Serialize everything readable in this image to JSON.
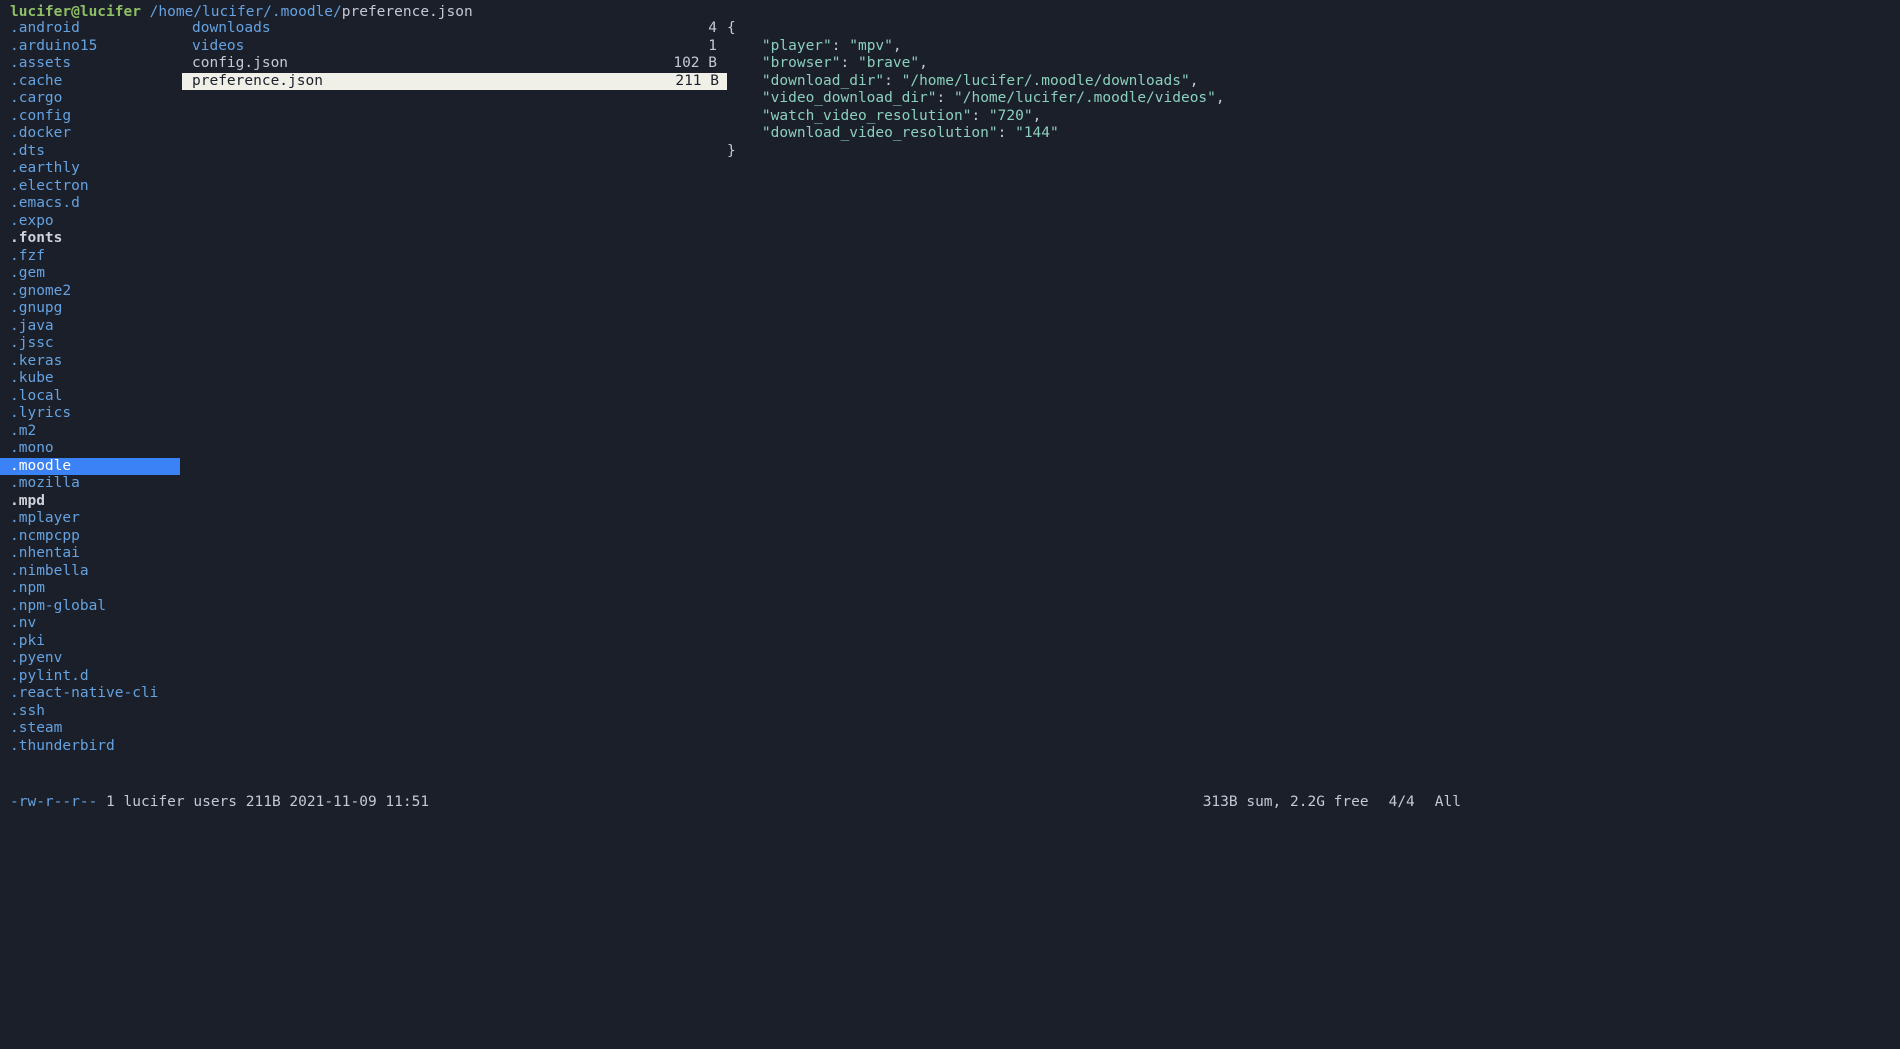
{
  "header": {
    "user_host": "lucifer@lucifer",
    "path_prefix": " /home/lucifer/.moodle/",
    "filename": "preference.json"
  },
  "left_column": [
    {
      "name": ".android",
      "type": "dir"
    },
    {
      "name": ".arduino15",
      "type": "dir"
    },
    {
      "name": ".assets",
      "type": "dir"
    },
    {
      "name": ".cache",
      "type": "dir"
    },
    {
      "name": ".cargo",
      "type": "dir"
    },
    {
      "name": ".config",
      "type": "dir"
    },
    {
      "name": ".docker",
      "type": "dir"
    },
    {
      "name": ".dts",
      "type": "dir"
    },
    {
      "name": ".earthly",
      "type": "dir"
    },
    {
      "name": ".electron",
      "type": "dir"
    },
    {
      "name": ".emacs.d",
      "type": "dir"
    },
    {
      "name": ".expo",
      "type": "dir"
    },
    {
      "name": ".fonts",
      "type": "dir",
      "bold": true
    },
    {
      "name": ".fzf",
      "type": "dir"
    },
    {
      "name": ".gem",
      "type": "dir"
    },
    {
      "name": ".gnome2",
      "type": "dir"
    },
    {
      "name": ".gnupg",
      "type": "dir"
    },
    {
      "name": ".java",
      "type": "dir"
    },
    {
      "name": ".jssc",
      "type": "dir"
    },
    {
      "name": ".keras",
      "type": "dir"
    },
    {
      "name": ".kube",
      "type": "dir"
    },
    {
      "name": ".local",
      "type": "dir"
    },
    {
      "name": ".lyrics",
      "type": "dir"
    },
    {
      "name": ".m2",
      "type": "dir"
    },
    {
      "name": ".mono",
      "type": "dir"
    },
    {
      "name": ".moodle",
      "type": "dir",
      "selected": true
    },
    {
      "name": ".mozilla",
      "type": "dir"
    },
    {
      "name": ".mpd",
      "type": "dir",
      "bold": true
    },
    {
      "name": ".mplayer",
      "type": "dir"
    },
    {
      "name": ".ncmpcpp",
      "type": "dir"
    },
    {
      "name": ".nhentai",
      "type": "dir"
    },
    {
      "name": ".nimbella",
      "type": "dir"
    },
    {
      "name": ".npm",
      "type": "dir"
    },
    {
      "name": ".npm-global",
      "type": "dir"
    },
    {
      "name": ".nv",
      "type": "dir"
    },
    {
      "name": ".pki",
      "type": "dir"
    },
    {
      "name": ".pyenv",
      "type": "dir"
    },
    {
      "name": ".pylint.d",
      "type": "dir"
    },
    {
      "name": ".react-native-cli",
      "type": "dir"
    },
    {
      "name": ".ssh",
      "type": "dir"
    },
    {
      "name": ".steam",
      "type": "dir"
    },
    {
      "name": ".thunderbird",
      "type": "dir"
    }
  ],
  "middle_column": [
    {
      "name": "downloads",
      "type": "dir",
      "size": "4"
    },
    {
      "name": "videos",
      "type": "dir",
      "size": "1"
    },
    {
      "name": "config.json",
      "type": "file",
      "size": "102 B"
    },
    {
      "name": "preference.json",
      "type": "file",
      "size": "211 B",
      "selected": true
    }
  ],
  "preview": {
    "lines": [
      "{",
      "    \"player\": \"mpv\",",
      "    \"browser\": \"brave\",",
      "    \"download_dir\": \"/home/lucifer/.moodle/downloads\",",
      "    \"video_download_dir\": \"/home/lucifer/.moodle/videos\",",
      "    \"watch_video_resolution\": \"720\",",
      "    \"download_video_resolution\": \"144\"",
      "}"
    ]
  },
  "footer": {
    "mode": "-rw-r--r--",
    "links": "1",
    "owner": "lucifer",
    "group": "users",
    "size": "211B",
    "date": "2021-11-09 11:51",
    "sum": "313B sum,",
    "free": "2.2G free",
    "position": "4/4",
    "scroll": "All"
  }
}
